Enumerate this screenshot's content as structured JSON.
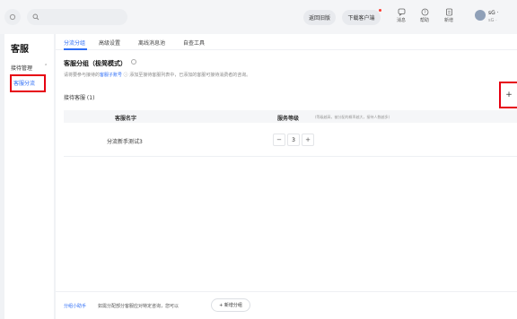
{
  "topbar": {
    "search_icon": "search-icon",
    "back_old_label": "返回旧版",
    "download_label": "下载客户端",
    "icons": [
      {
        "name": "message-icon",
        "label": "消息"
      },
      {
        "name": "help-icon",
        "label": "帮助"
      },
      {
        "name": "new-icon",
        "label": "新增"
      }
    ],
    "user_name": "sG ·",
    "user_sub": "sG ·"
  },
  "sidebar": {
    "title": "客服",
    "group_label": "接待管理",
    "group_caret": "⌃",
    "item_label": "客服分流"
  },
  "tabs": [
    {
      "label": "分流分组"
    },
    {
      "label": "高级设置"
    },
    {
      "label": "离线消息池"
    },
    {
      "label": "自查工具"
    }
  ],
  "section": {
    "title": "客服分组（极简模式）",
    "desc_before": "请将要参与接待的",
    "desc_link": "客服子账号",
    "desc_after": " ⓘ 添加至接待客服列表中，已添加的客服可接待消费者的咨询。",
    "staff_label": "接待客服 (1)",
    "plus_label": "+"
  },
  "table": {
    "col_name": "客服名字",
    "col_level": "服务等级",
    "col_level_note": "(等级越高，被分配的概率越大，接待人数越多)",
    "rows": [
      {
        "name": "分流新手测试3",
        "level": "3"
      }
    ],
    "minus": "−",
    "plus": "+"
  },
  "footer": {
    "assistant_link": "分组小助手",
    "text": "如需分配部分客服应对特定咨询，您可以",
    "add_group_button": "+ 新增分组"
  }
}
